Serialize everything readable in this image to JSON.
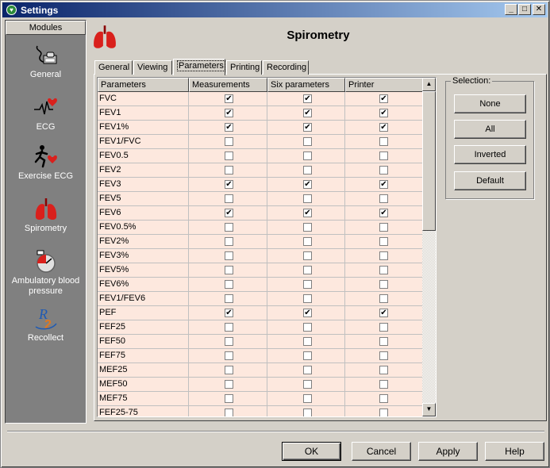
{
  "window": {
    "title": "Settings",
    "minimize": "_",
    "maximize": "□",
    "close": "✕"
  },
  "modules": {
    "header": "Modules",
    "items": [
      {
        "label": "General",
        "icon": "mouse-keyboard-icon"
      },
      {
        "label": "ECG",
        "icon": "heart-ecg-icon"
      },
      {
        "label": "Exercise ECG",
        "icon": "running-heart-icon"
      },
      {
        "label": "Spirometry",
        "icon": "lungs-icon"
      },
      {
        "label": "Ambulatory blood\npressure",
        "icon": "blood-pressure-icon"
      },
      {
        "label": "Recollect",
        "icon": "recollect-icon"
      }
    ]
  },
  "header": {
    "title": "Spirometry",
    "icon": "lungs-icon"
  },
  "tabs": [
    {
      "label": "General",
      "active": false
    },
    {
      "label": "Viewing",
      "active": false
    },
    {
      "label": "Parameters",
      "active": true
    },
    {
      "label": "Printing",
      "active": false
    },
    {
      "label": "Recording",
      "active": false
    }
  ],
  "grid": {
    "columns": [
      "Parameters",
      "Measurements",
      "Six parameters",
      "Printer"
    ],
    "rows": [
      {
        "name": "FVC",
        "m": true,
        "s": true,
        "p": true
      },
      {
        "name": "FEV1",
        "m": true,
        "s": true,
        "p": true
      },
      {
        "name": "FEV1%",
        "m": true,
        "s": true,
        "p": true
      },
      {
        "name": "FEV1/FVC",
        "m": false,
        "s": false,
        "p": false
      },
      {
        "name": "FEV0.5",
        "m": false,
        "s": false,
        "p": false
      },
      {
        "name": "FEV2",
        "m": false,
        "s": false,
        "p": false
      },
      {
        "name": "FEV3",
        "m": true,
        "s": true,
        "p": true
      },
      {
        "name": "FEV5",
        "m": false,
        "s": false,
        "p": false
      },
      {
        "name": "FEV6",
        "m": true,
        "s": true,
        "p": true
      },
      {
        "name": "FEV0.5%",
        "m": false,
        "s": false,
        "p": false
      },
      {
        "name": "FEV2%",
        "m": false,
        "s": false,
        "p": false
      },
      {
        "name": "FEV3%",
        "m": false,
        "s": false,
        "p": false
      },
      {
        "name": "FEV5%",
        "m": false,
        "s": false,
        "p": false
      },
      {
        "name": "FEV6%",
        "m": false,
        "s": false,
        "p": false
      },
      {
        "name": "FEV1/FEV6",
        "m": false,
        "s": false,
        "p": false
      },
      {
        "name": "PEF",
        "m": true,
        "s": true,
        "p": true
      },
      {
        "name": "FEF25",
        "m": false,
        "s": false,
        "p": false
      },
      {
        "name": "FEF50",
        "m": false,
        "s": false,
        "p": false
      },
      {
        "name": "FEF75",
        "m": false,
        "s": false,
        "p": false
      },
      {
        "name": "MEF25",
        "m": false,
        "s": false,
        "p": false
      },
      {
        "name": "MEF50",
        "m": false,
        "s": false,
        "p": false
      },
      {
        "name": "MEF75",
        "m": false,
        "s": false,
        "p": false
      },
      {
        "name": "FEF25-75",
        "m": false,
        "s": false,
        "p": false
      }
    ],
    "check_glyph": "✔",
    "scroll_up": "▲",
    "scroll_down": "▼"
  },
  "selection": {
    "label": "Selection:",
    "buttons": [
      "None",
      "All",
      "Inverted",
      "Default"
    ]
  },
  "footer": {
    "ok": "OK",
    "cancel": "Cancel",
    "apply": "Apply",
    "help": "Help"
  },
  "colors": {
    "row_alt": "#fde8de",
    "title_start": "#0a246a",
    "title_end": "#a6caf0",
    "lungs": "#d9201c"
  }
}
